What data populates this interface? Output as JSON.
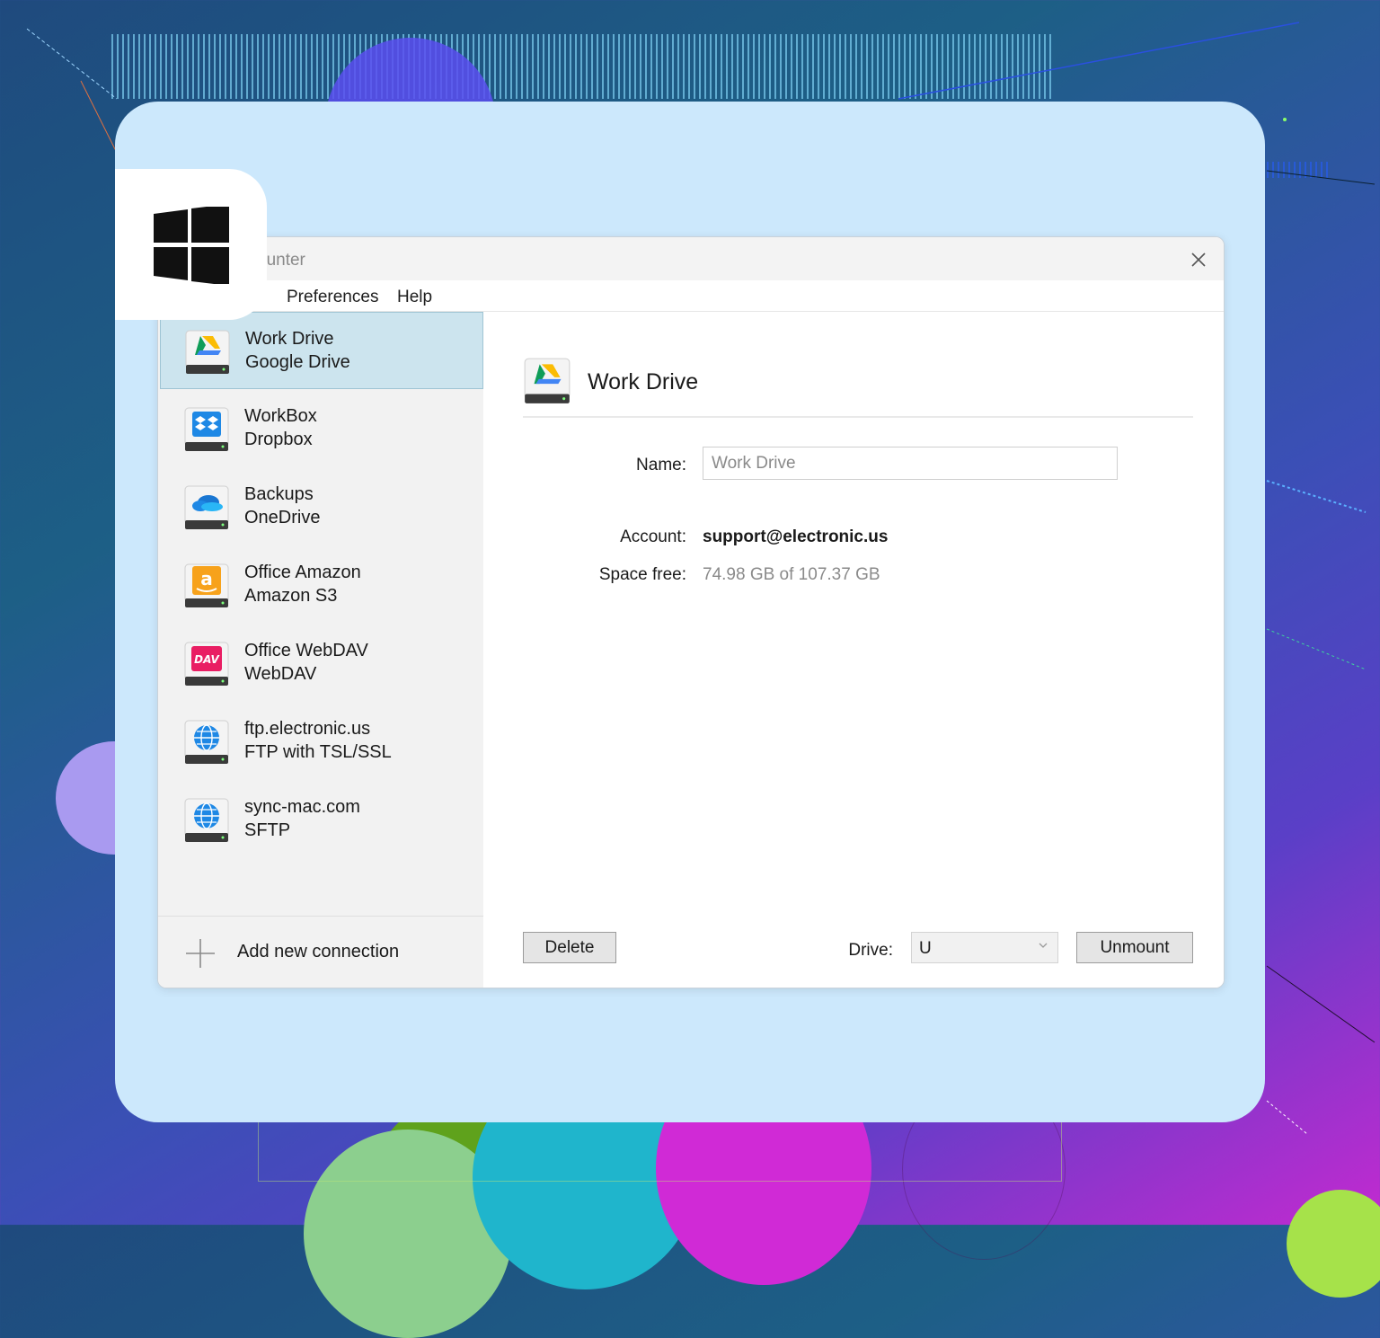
{
  "window": {
    "title_partial": "ounter",
    "close_glyph": "✕"
  },
  "menu": {
    "items": [
      "Preferences",
      "Help"
    ]
  },
  "connections": [
    {
      "name": "Work Drive",
      "type": "Google Drive",
      "icon": "google-drive-icon",
      "selected": true
    },
    {
      "name": "WorkBox",
      "type": "Dropbox",
      "icon": "dropbox-icon",
      "selected": false
    },
    {
      "name": "Backups",
      "type": "OneDrive",
      "icon": "onedrive-icon",
      "selected": false
    },
    {
      "name": "Office Amazon",
      "type": "Amazon S3",
      "icon": "amazon-s3-icon",
      "selected": false
    },
    {
      "name": "Office WebDAV",
      "type": "WebDAV",
      "icon": "webdav-icon",
      "selected": false
    },
    {
      "name": "ftp.electronic.us",
      "type": "FTP with TSL/SSL",
      "icon": "globe-icon",
      "selected": false
    },
    {
      "name": "sync-mac.com",
      "type": "SFTP",
      "icon": "globe-icon",
      "selected": false
    }
  ],
  "sidebar_footer": {
    "add_label": "Add new connection"
  },
  "detail": {
    "title": "Work Drive",
    "name_label": "Name:",
    "name_value": "Work Drive",
    "account_label": "Account:",
    "account_value": "support@electronic.us",
    "space_label": "Space free:",
    "space_value": "74.98 GB of 107.37 GB"
  },
  "footer": {
    "delete_label": "Delete",
    "drive_label": "Drive:",
    "drive_value": "U",
    "unmount_label": "Unmount"
  },
  "colors": {
    "card_bg": "#cce8fc",
    "selected_bg": "#cce4ee",
    "sidebar_bg": "#f2f2f2"
  }
}
